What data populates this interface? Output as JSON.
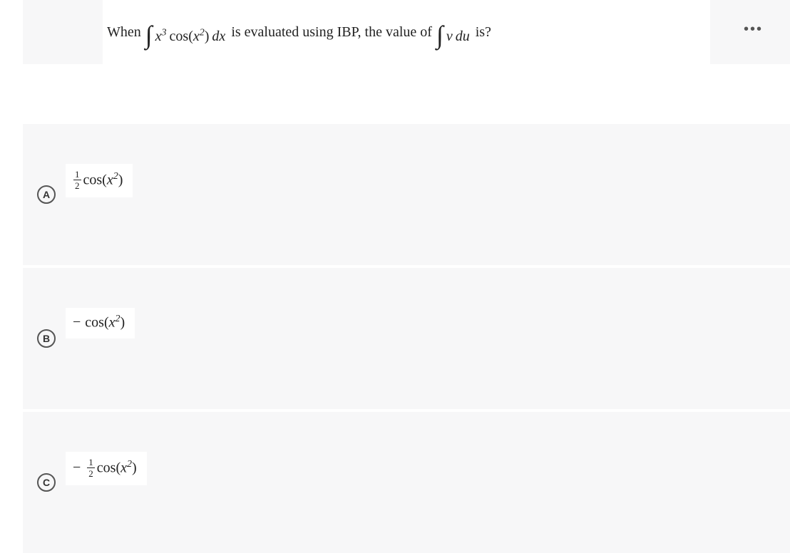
{
  "question": {
    "prefix": "When",
    "integral_expr": "∫ x³ cos(x²) dx",
    "mid": "is evaluated using IBP, the value of",
    "integral_vdu": "∫ v du",
    "suffix": "is?"
  },
  "choices": [
    {
      "letter": "A",
      "expr_desc": "½ cos(x²)"
    },
    {
      "letter": "B",
      "expr_desc": "− cos(x²)"
    },
    {
      "letter": "C",
      "expr_desc": "−½ cos(x²)"
    }
  ],
  "icons": {
    "more": "more-icon"
  }
}
